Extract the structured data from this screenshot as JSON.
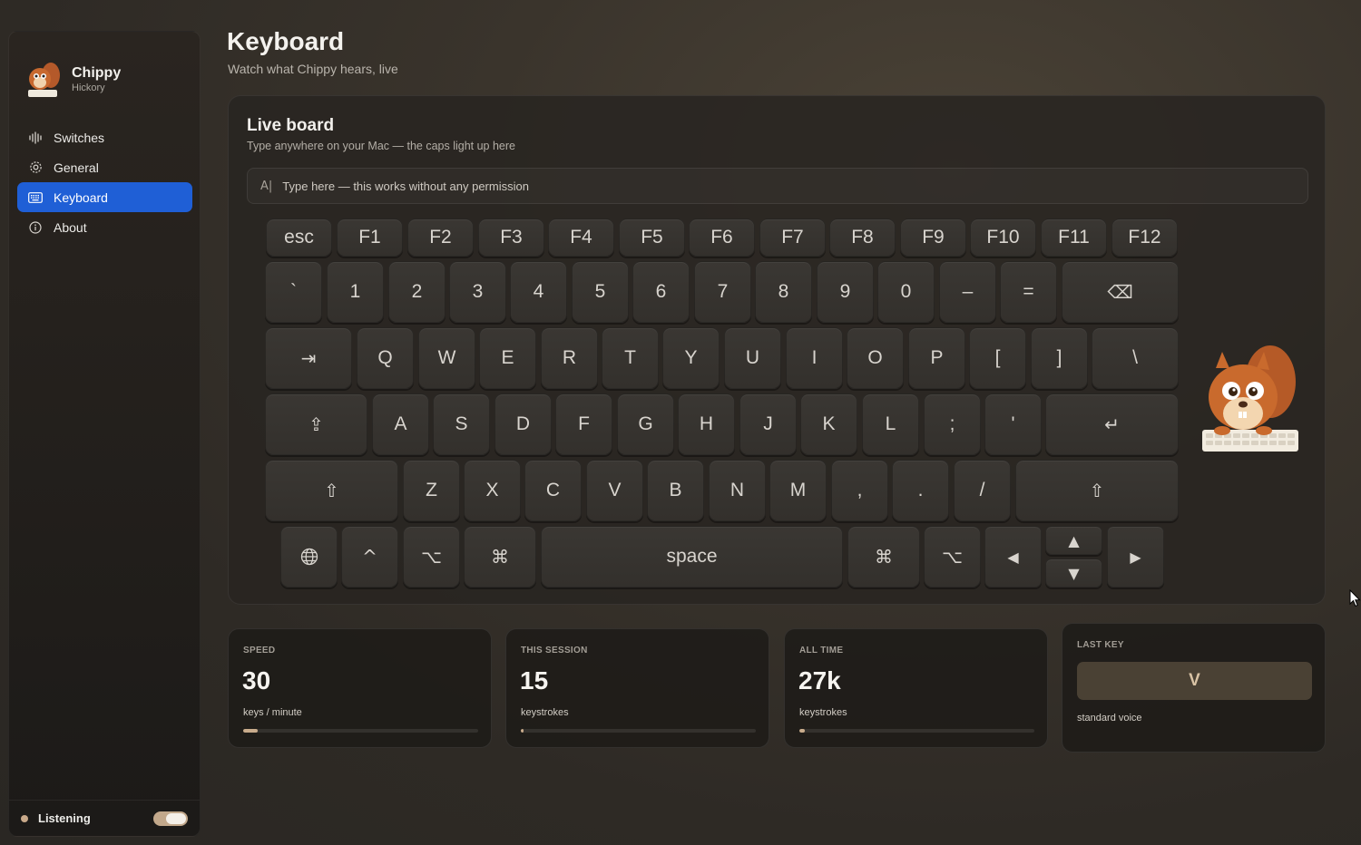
{
  "sidebar": {
    "profile": {
      "name": "Chippy",
      "subtitle": "Hickory"
    },
    "items": [
      {
        "label": "Switches",
        "icon": "waveform-icon"
      },
      {
        "label": "General",
        "icon": "gear-icon"
      },
      {
        "label": "Keyboard",
        "icon": "keyboard-icon",
        "active": true
      },
      {
        "label": "About",
        "icon": "info-icon"
      }
    ],
    "footer": {
      "label": "Listening",
      "toggle_on": true
    }
  },
  "header": {
    "title": "Keyboard",
    "subtitle": "Watch what Chippy hears, live"
  },
  "board": {
    "title": "Live board",
    "subtitle": "Type anywhere on your Mac — the caps light up here",
    "input_placeholder": "Type here — this works without any permission",
    "keys": {
      "fn_row": [
        "esc",
        "F1",
        "F2",
        "F3",
        "F4",
        "F5",
        "F6",
        "F7",
        "F8",
        "F9",
        "F10",
        "F11",
        "F12"
      ],
      "num_row": [
        "`",
        "1",
        "2",
        "3",
        "4",
        "5",
        "6",
        "7",
        "8",
        "9",
        "0",
        "–",
        "=",
        "⌫"
      ],
      "top_row": [
        "⇥",
        "Q",
        "W",
        "E",
        "R",
        "T",
        "Y",
        "U",
        "I",
        "O",
        "P",
        "[",
        "]",
        "\\"
      ],
      "home_row": [
        "⇪",
        "A",
        "S",
        "D",
        "F",
        "G",
        "H",
        "J",
        "K",
        "L",
        ";",
        "'",
        "↵"
      ],
      "bottom_row": [
        "⇧",
        "Z",
        "X",
        "C",
        "V",
        "B",
        "N",
        "M",
        ",",
        ".",
        "/",
        "⇧"
      ],
      "mod_row": [
        "🌐",
        "^",
        "⌥",
        "⌘",
        "space",
        "⌘",
        "⌥",
        "◀",
        "▲",
        "▼",
        "▶"
      ]
    }
  },
  "stats": {
    "speed": {
      "label": "SPEED",
      "value": "30",
      "unit": "keys / minute",
      "progress": 0.06
    },
    "session": {
      "label": "THIS SESSION",
      "value": "15",
      "unit": "keystrokes",
      "progress": 0.01
    },
    "all_time": {
      "label": "ALL TIME",
      "value": "27k",
      "unit": "keystrokes",
      "progress": 0.025
    },
    "last_key": {
      "label": "LAST KEY",
      "value": "V",
      "voice": "standard voice"
    }
  },
  "colors": {
    "accent": "#1f5fd6",
    "progress": "#c9ac8c"
  }
}
